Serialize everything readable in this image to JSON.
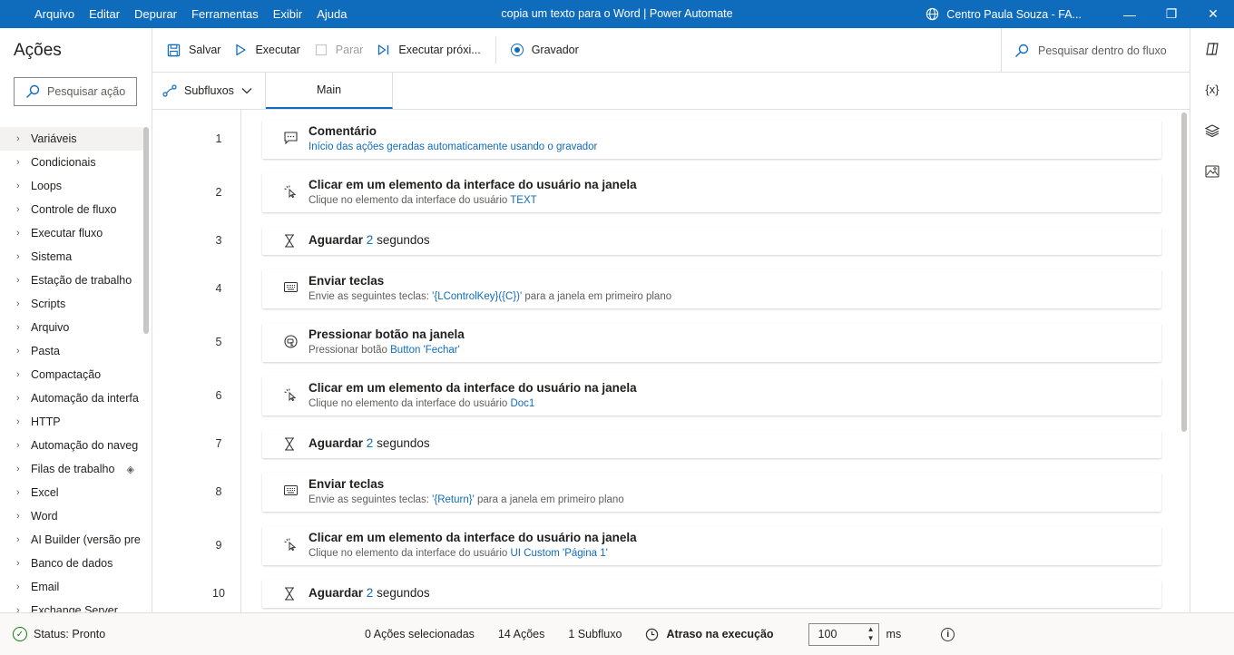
{
  "window": {
    "title": "copia um texto para o Word | Power Automate",
    "organization": "Centro Paula Souza - FA...",
    "controls": {
      "minimize": "—",
      "restore": "❐",
      "close": "✕"
    }
  },
  "menu": [
    "Arquivo",
    "Editar",
    "Depurar",
    "Ferramentas",
    "Exibir",
    "Ajuda"
  ],
  "actions_pane": {
    "title": "Ações",
    "search_placeholder": "Pesquisar ação",
    "categories": [
      "Variáveis",
      "Condicionais",
      "Loops",
      "Controle de fluxo",
      "Executar fluxo",
      "Sistema",
      "Estação de trabalho",
      "Scripts",
      "Arquivo",
      "Pasta",
      "Compactação",
      "Automação da interfa",
      "HTTP",
      "Automação do naveg",
      "Filas de trabalho",
      "Excel",
      "Word",
      "AI Builder (versão pre",
      "Banco de dados",
      "Email",
      "Exchange Server"
    ]
  },
  "toolbar": {
    "save": "Salvar",
    "run": "Executar",
    "stop": "Parar",
    "run_next": "Executar próxi...",
    "recorder": "Gravador",
    "search_placeholder": "Pesquisar dentro do fluxo"
  },
  "tabs": {
    "subflows": "Subfluxos",
    "main": "Main"
  },
  "flow_steps": [
    {
      "line": "1",
      "icon": "comment-icon",
      "title": "Comentário",
      "subtitle_prefix": "",
      "subtitle_value": "Início das ações geradas automaticamente usando o gravador",
      "subtitle_suffix": ""
    },
    {
      "line": "2",
      "icon": "click-icon",
      "title": "Clicar em um elemento da interface do usuário na janela",
      "subtitle_prefix": "Clique no elemento da interface do usuário ",
      "subtitle_value": "TEXT",
      "subtitle_suffix": ""
    },
    {
      "line": "3",
      "icon": "hourglass-icon",
      "title": "Aguardar",
      "value": "2",
      "unit": "segundos"
    },
    {
      "line": "4",
      "icon": "keyboard-icon",
      "title": "Enviar teclas",
      "subtitle_prefix": "Envie as seguintes teclas: ",
      "subtitle_value": "'{LControlKey}({C})'",
      "subtitle_suffix": " para a janela em primeiro plano"
    },
    {
      "line": "5",
      "icon": "press-button-icon",
      "title": "Pressionar botão na janela",
      "subtitle_prefix": "Pressionar botão ",
      "subtitle_value": "Button 'Fechar'",
      "subtitle_suffix": ""
    },
    {
      "line": "6",
      "icon": "click-icon",
      "title": "Clicar em um elemento da interface do usuário na janela",
      "subtitle_prefix": "Clique no elemento da interface do usuário ",
      "subtitle_value": "Doc1",
      "subtitle_suffix": ""
    },
    {
      "line": "7",
      "icon": "hourglass-icon",
      "title": "Aguardar",
      "value": "2",
      "unit": "segundos"
    },
    {
      "line": "8",
      "icon": "keyboard-icon",
      "title": "Enviar teclas",
      "subtitle_prefix": "Envie as seguintes teclas: ",
      "subtitle_value": "'{Return}'",
      "subtitle_suffix": " para a janela em primeiro plano"
    },
    {
      "line": "9",
      "icon": "click-icon",
      "title": "Clicar em um elemento da interface do usuário na janela",
      "subtitle_prefix": "Clique no elemento da interface do usuário ",
      "subtitle_value": "UI Custom 'Página 1'",
      "subtitle_suffix": ""
    },
    {
      "line": "10",
      "icon": "hourglass-icon",
      "title": "Aguardar",
      "value": "2",
      "unit": "segundos"
    }
  ],
  "status_bar": {
    "status": "Status: Pronto",
    "selected": "0 Ações selecionadas",
    "actions": "14 Ações",
    "subflows": "1 Subfluxo",
    "delay_label": "Atraso na execução",
    "delay_value": "100",
    "delay_unit": "ms"
  },
  "colors": {
    "accent": "#0f6cbd",
    "ok": "#107c10"
  }
}
